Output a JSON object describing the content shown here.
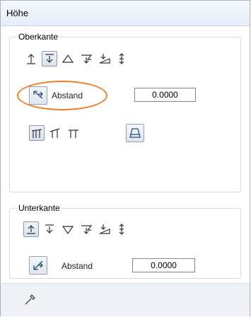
{
  "window": {
    "title": "Höhe"
  },
  "upper_edge": {
    "group_label": "Oberkante",
    "icons": [
      "arrow-up-from-line-icon",
      "arrow-down-to-line-icon",
      "triangle-up-icon",
      "plane-down-icon",
      "slope-plane-icon",
      "height-adjust-icon"
    ],
    "selected_icon": "arrow-down-to-line-icon",
    "distance_label": "Abstand",
    "distance_value": "0.0000",
    "distance_icon": "slope-distance-icon",
    "roof_icons": [
      "roof-frame-icon",
      "roof-frame-half-icon",
      "roof-frame-open-icon"
    ],
    "selected_roof_icon": "roof-frame-icon",
    "extra_icon": "trapezoid-icon"
  },
  "lower_edge": {
    "group_label": "Unterkante",
    "icons": [
      "arrow-up-box-icon",
      "arrow-down-to-line-icon",
      "triangle-down-icon",
      "plane-down-icon",
      "slope-plane-icon",
      "height-adjust-icon"
    ],
    "selected_icon": "arrow-up-box-icon",
    "distance_label": "Abstand",
    "distance_value": "0.0000",
    "distance_icon": "slope-distance-icon"
  },
  "footer": {
    "icon": "eyedropper-icon"
  },
  "colors": {
    "highlight": "#ef7f2a",
    "border": "#a9b4c2"
  }
}
